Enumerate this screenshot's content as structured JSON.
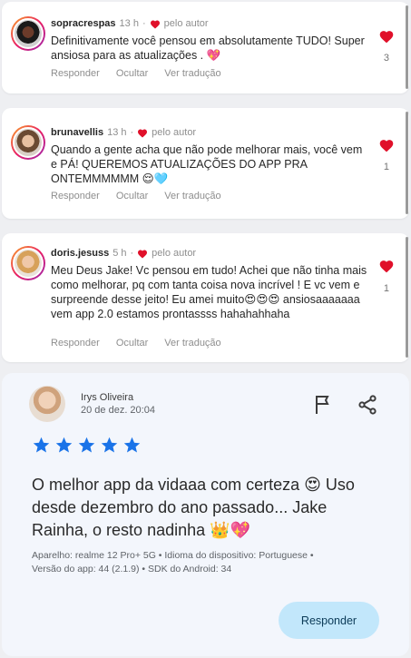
{
  "colors": {
    "heart": "#e0102a",
    "star": "#1a73e8",
    "reply_bg": "#c2e7fb",
    "card_bg": "#ffffff",
    "review_bg": "#f3f6fc"
  },
  "comments": [
    {
      "username": "sopracrespas",
      "time": "13 h",
      "separator": "·",
      "author_label": "pelo autor",
      "text": "Definitivamente você pensou em absolutamente TUDO! Super ansiosa para as atualizações . 💖",
      "likes": "3",
      "actions": {
        "reply": "Responder",
        "hide": "Ocultar",
        "translate": "Ver tradução"
      }
    },
    {
      "username": "brunavellis",
      "time": "13 h",
      "separator": "·",
      "author_label": "pelo autor",
      "text": "Quando a gente acha que não pode melhorar mais, você vem e PÁ! QUEREMOS ATUALIZAÇÕES DO APP PRA ONTEMMMMMM 😌🩵",
      "likes": "1",
      "actions": {
        "reply": "Responder",
        "hide": "Ocultar",
        "translate": "Ver tradução"
      }
    },
    {
      "username": "doris.jesuss",
      "time": "5 h",
      "separator": "·",
      "author_label": "pelo autor",
      "text": "Meu Deus Jake! Vc pensou em tudo! Achei que não tinha mais como melhorar, pq com tanta coisa nova incrível ! E vc vem e surpreende desse jeito! Eu amei muito😍😍😍 ansiosaaaaaaa vem app 2.0 estamos prontassss hahahahhaha",
      "likes": "1",
      "actions": {
        "reply": "Responder",
        "hide": "Ocultar",
        "translate": "Ver tradução"
      }
    }
  ],
  "review": {
    "reviewer": "Irys Oliveira",
    "date": "20 de dez. 20:04",
    "rating": 5,
    "text": "O melhor app da vidaaa com certeza 😍 Uso desde dezembro do ano passado... Jake Rainha, o resto nadinha 👑💖",
    "device_line1": "Aparelho: realme 12 Pro+ 5G • Idioma do dispositivo: Portuguese •",
    "device_line2": "Versão do app: 44 (2.1.9) • SDK do Android: 34",
    "reply_label": "Responder",
    "icons": {
      "flag": "flag-icon",
      "share": "share-icon"
    }
  }
}
